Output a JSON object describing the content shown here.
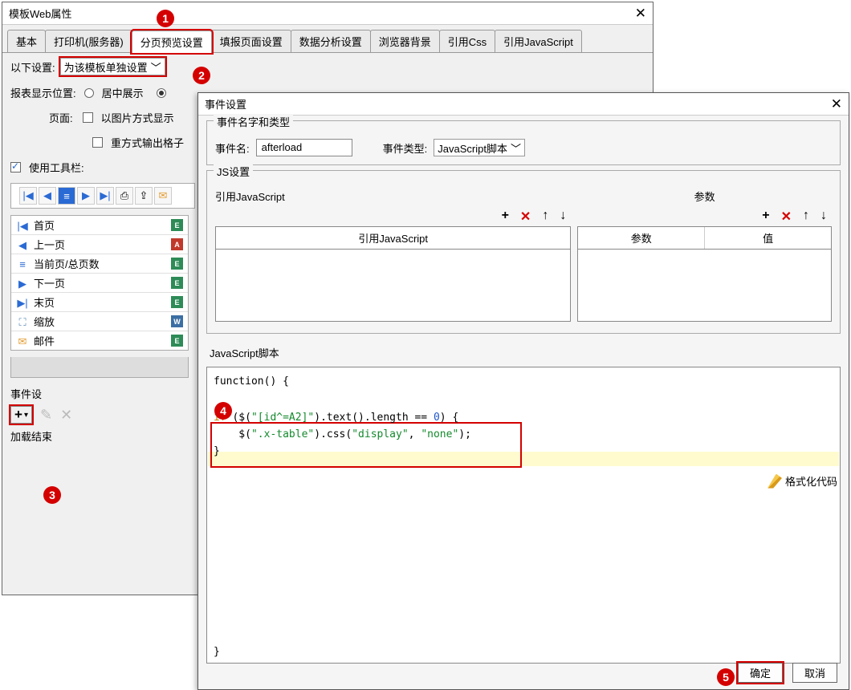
{
  "back": {
    "title": "模板Web属性",
    "tabs": [
      "基本",
      "打印机(服务器)",
      "分页预览设置",
      "填报页面设置",
      "数据分析设置",
      "浏览器背景",
      "引用Css",
      "引用JavaScript"
    ],
    "activeTab": 2,
    "settingLabel": "以下设置:",
    "settingSelect": "为该模板单独设置",
    "reportPosLabel": "报表显示位置:",
    "radioCenter": "居中展示",
    "pageLabel": "页面:",
    "chkImg": "以图片方式显示",
    "chkGrid": "重方式输出格子",
    "chkToolbar": "使用工具栏:",
    "nav": [
      {
        "i": "|◀",
        "c": "#2a6ad4",
        "t": "首页",
        "r": "E",
        "rc": "#2e8b57"
      },
      {
        "i": "◀",
        "c": "#2a6ad4",
        "t": "上一页",
        "r": "",
        "rc": "#c0392b",
        "rimg": "pdf"
      },
      {
        "i": "≡",
        "c": "#2a6ad4",
        "t": "当前页/总页数",
        "r": "E",
        "rc": "#2e8b57"
      },
      {
        "i": "▶",
        "c": "#2a6ad4",
        "t": "下一页",
        "r": "E",
        "rc": "#2e8b57"
      },
      {
        "i": "▶|",
        "c": "#2a6ad4",
        "t": "末页",
        "r": "E",
        "rc": "#2e8b57"
      },
      {
        "i": "⛶",
        "c": "#5b8bb5",
        "t": "缩放",
        "r": "W",
        "rc": "#3b6fa3"
      },
      {
        "i": "✉",
        "c": "#e39b2e",
        "t": "邮件",
        "r": "E",
        "rc": "#2e8b57"
      }
    ],
    "evLabel": "事件设",
    "addEnd": "加载结束"
  },
  "dlg": {
    "title": "事件设置",
    "grp1": "事件名字和类型",
    "evNameL": "事件名:",
    "evName": "afterload",
    "evTypeL": "事件类型:",
    "evType": "JavaScript脚本",
    "grp2": "JS设置",
    "refJs": "引用JavaScript",
    "refJsHead": "引用JavaScript",
    "param": "参数",
    "paramHead": "参数",
    "valHead": "值",
    "jsScript": "JavaScript脚本",
    "fnOpen": "function() {",
    "fnClose": "}",
    "codeL1_a": "if ",
    "codeL1_b": "($(",
    "codeL1_c": "\"[id^=A2]\"",
    "codeL1_d": ").text().length == ",
    "codeL1_e": "0",
    "codeL1_f": ") {",
    "codeL2_a": "    $(",
    "codeL2_b": "\".x-table\"",
    "codeL2_c": ").css(",
    "codeL2_d": "\"display\"",
    "codeL2_e": ", ",
    "codeL2_f": "\"none\"",
    "codeL2_g": ");",
    "codeL3": "}",
    "format": "格式化代码",
    "ok": "确定",
    "cancel": "取消"
  },
  "markers": {
    "1": "1",
    "2": "2",
    "3": "3",
    "4": "4",
    "5": "5"
  }
}
